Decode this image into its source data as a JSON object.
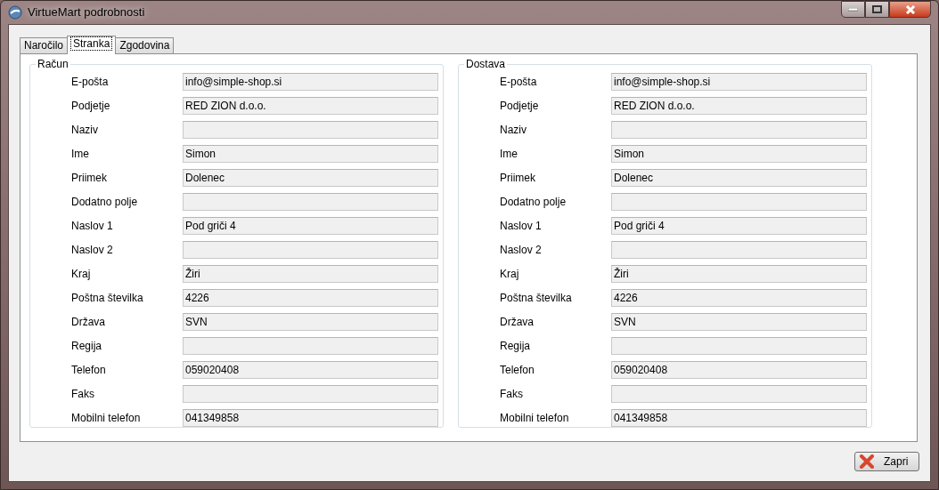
{
  "window": {
    "title": "VirtueMart podrobnosti"
  },
  "tabs": [
    {
      "label": "Naročilo",
      "selected": false
    },
    {
      "label": "Stranka",
      "selected": true
    },
    {
      "label": "Zgodovina",
      "selected": false
    }
  ],
  "groups": [
    {
      "title": "Račun",
      "fields": [
        {
          "label": "E-pošta",
          "value": "info@simple-shop.si"
        },
        {
          "label": "Podjetje",
          "value": "RED ZION d.o.o."
        },
        {
          "label": "Naziv"
        },
        {
          "label": "Ime",
          "value": "Simon"
        },
        {
          "label": "Priimek",
          "value": "Dolenec"
        },
        {
          "label": "Dodatno polje"
        },
        {
          "label": "Naslov 1",
          "value": "Pod griči 4"
        },
        {
          "label": "Naslov 2"
        },
        {
          "label": "Kraj",
          "value": "Žiri"
        },
        {
          "label": "Poštna številka",
          "value": "4226"
        },
        {
          "label": "Država",
          "value": "SVN"
        },
        {
          "label": "Regija"
        },
        {
          "label": "Telefon",
          "value": "059020408"
        },
        {
          "label": "Faks"
        },
        {
          "label": "Mobilni telefon",
          "value": "041349858"
        }
      ]
    },
    {
      "title": "Dostava",
      "fields": [
        {
          "label": "E-pošta",
          "value": "info@simple-shop.si"
        },
        {
          "label": "Podjetje",
          "value": "RED ZION d.o.o."
        },
        {
          "label": "Naziv"
        },
        {
          "label": "Ime",
          "value": "Simon"
        },
        {
          "label": "Priimek",
          "value": "Dolenec"
        },
        {
          "label": "Dodatno polje"
        },
        {
          "label": "Naslov 1",
          "value": "Pod griči 4"
        },
        {
          "label": "Naslov 2"
        },
        {
          "label": "Kraj",
          "value": "Žiri"
        },
        {
          "label": "Poštna številka",
          "value": "4226"
        },
        {
          "label": "Država",
          "value": "SVN"
        },
        {
          "label": "Regija"
        },
        {
          "label": "Telefon",
          "value": "059020408"
        },
        {
          "label": "Faks"
        },
        {
          "label": "Mobilni telefon",
          "value": "041349858"
        }
      ]
    }
  ],
  "buttons": [
    {
      "label": "Zapri"
    }
  ]
}
